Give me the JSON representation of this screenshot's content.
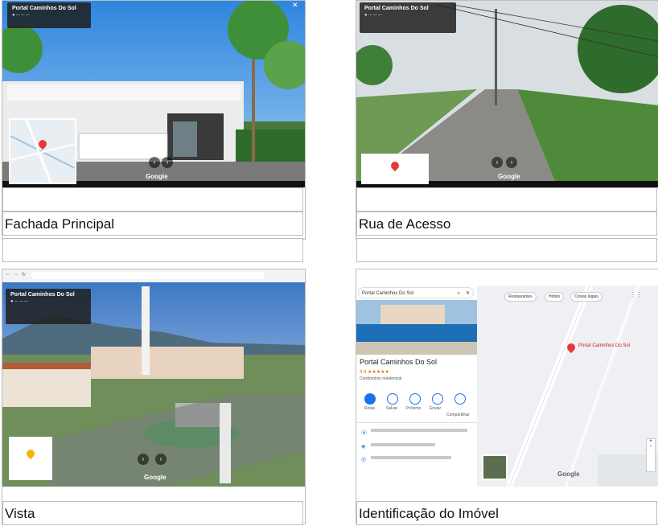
{
  "panels": [
    {
      "caption": "Fachada Principal",
      "streetview": {
        "place": "Portal Caminhos Do Sol",
        "brand": "Google"
      }
    },
    {
      "caption": "Rua de Acesso",
      "streetview": {
        "place": "Portal Caminhos Do Sol",
        "brand": "Google"
      }
    },
    {
      "caption": "Vista",
      "streetview": {
        "place": "Portal Caminhos Do Sol",
        "brand": "Google"
      }
    },
    {
      "caption": "Identificação do Imóvel",
      "maps": {
        "search_value": "Portal Caminhos Do Sol",
        "place_title": "Portal Caminhos Do Sol",
        "rating": "4.4 ★★★★★",
        "actions": [
          "Rotas",
          "Salvar",
          "Próximo",
          "Enviar",
          "Compartilhar"
        ],
        "map_pin_label": "Portal Caminhos Do Sol",
        "chips": [
          "Restaurantes",
          "Hotéis",
          "Coisas legais"
        ],
        "brand": "Google"
      }
    }
  ],
  "colors": {
    "sky": "#4a90d9",
    "grass": "#3f8f3a",
    "pin": "#e53935",
    "maps_blue": "#1a73e8"
  }
}
